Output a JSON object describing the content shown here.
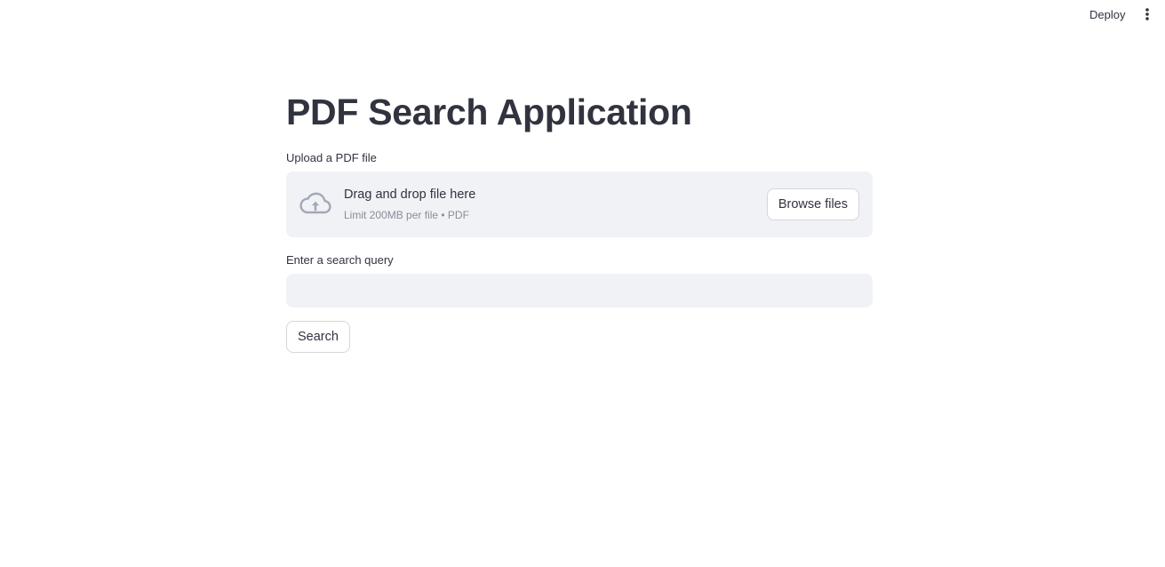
{
  "header": {
    "deploy_label": "Deploy",
    "menu_icon": "more-vertical-icon"
  },
  "main": {
    "title": "PDF Search Application",
    "uploader": {
      "label": "Upload a PDF file",
      "drop_title": "Drag and drop file here",
      "drop_limit": "Limit 200MB per file • PDF",
      "browse_label": "Browse files",
      "icon": "cloud-upload-icon"
    },
    "query": {
      "label": "Enter a search query",
      "value": "",
      "placeholder": ""
    },
    "search_label": "Search"
  },
  "colors": {
    "text": "#31333f",
    "muted": "#8b8d98",
    "input_bg": "#f0f2f6",
    "border": "#d6d6d9",
    "icon": "#a3a8b8"
  }
}
